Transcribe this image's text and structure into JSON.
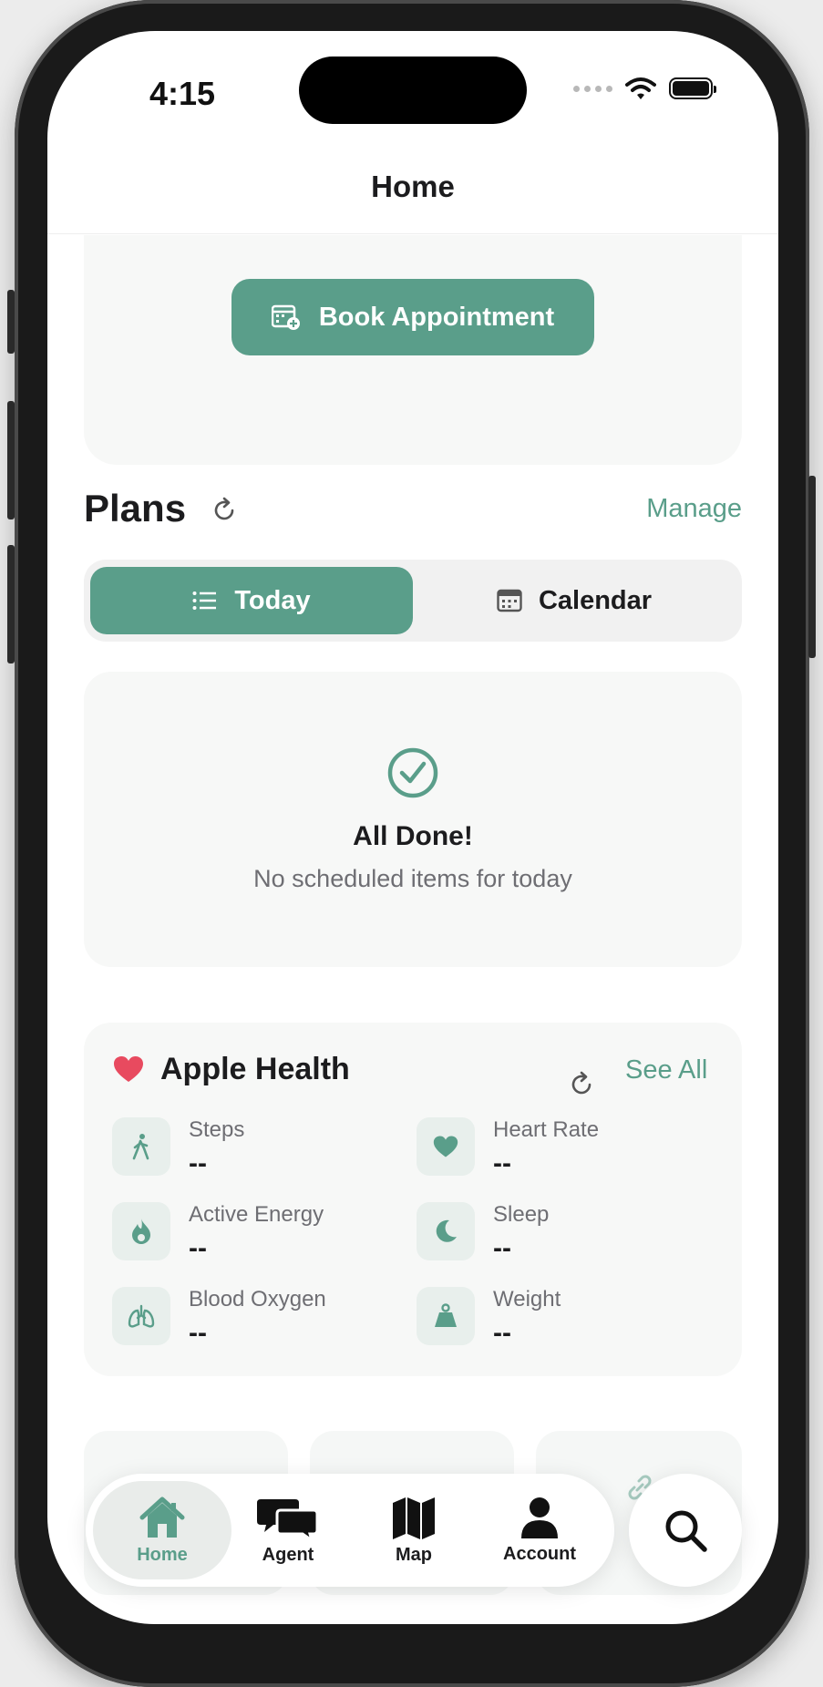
{
  "status_bar": {
    "time": "4:15"
  },
  "header": {
    "title": "Home"
  },
  "appointment": {
    "button_label": "Book Appointment"
  },
  "plans": {
    "title": "Plans",
    "manage_label": "Manage",
    "tabs": [
      {
        "label": "Today",
        "selected": true,
        "icon": "list-icon"
      },
      {
        "label": "Calendar",
        "selected": false,
        "icon": "calendar-icon"
      }
    ],
    "empty_title": "All Done!",
    "empty_subtitle": "No scheduled items for today"
  },
  "health": {
    "title": "Apple Health",
    "see_all_label": "See All",
    "metrics": [
      {
        "label": "Steps",
        "value": "--",
        "icon": "walking-icon"
      },
      {
        "label": "Heart Rate",
        "value": "--",
        "icon": "heart-icon"
      },
      {
        "label": "Active Energy",
        "value": "--",
        "icon": "flame-icon"
      },
      {
        "label": "Sleep",
        "value": "--",
        "icon": "moon-icon"
      },
      {
        "label": "Blood Oxygen",
        "value": "--",
        "icon": "lungs-icon"
      },
      {
        "label": "Weight",
        "value": "--",
        "icon": "scale-icon"
      }
    ]
  },
  "tab_bar": {
    "items": [
      {
        "label": "Home",
        "active": true
      },
      {
        "label": "Agent",
        "active": false
      },
      {
        "label": "Map",
        "active": false
      },
      {
        "label": "Account",
        "active": false
      }
    ]
  },
  "colors": {
    "accent": "#5a9e8a",
    "heart": "#e84a5f",
    "text": "#1c1c1e",
    "muted": "#6e6e73"
  }
}
